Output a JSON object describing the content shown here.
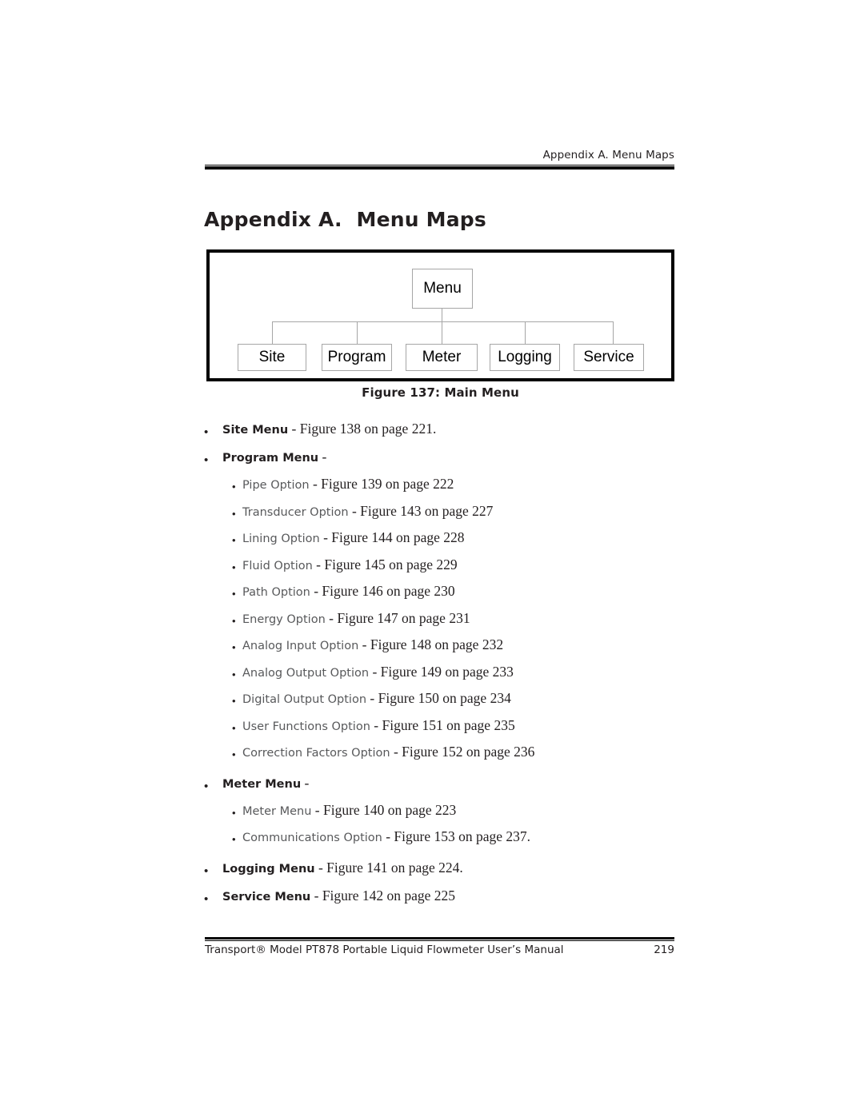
{
  "header": {
    "running_head": "Appendix A. Menu Maps"
  },
  "title": "Appendix A.  Menu Maps",
  "figure": {
    "caption": "Figure 137: Main Menu",
    "root": "Menu",
    "children": [
      "Site",
      "Program",
      "Meter",
      "Logging",
      "Service"
    ]
  },
  "list": [
    {
      "level": 1,
      "label": "Site Menu",
      "ref": " - Figure 138 on page 221."
    },
    {
      "level": 1,
      "label": "Program Menu",
      "ref": " -"
    },
    {
      "level": 2,
      "label": "Pipe Option",
      "ref": " - Figure 139 on page 222"
    },
    {
      "level": 2,
      "label": "Transducer Option",
      "ref": " - Figure 143 on page 227"
    },
    {
      "level": 2,
      "label": "Lining Option",
      "ref": " - Figure 144 on page 228"
    },
    {
      "level": 2,
      "label": "Fluid Option",
      "ref": " - Figure 145 on page 229"
    },
    {
      "level": 2,
      "label": "Path Option",
      "ref": " - Figure 146 on page 230"
    },
    {
      "level": 2,
      "label": "Energy Option",
      "ref": " - Figure 147 on page 231"
    },
    {
      "level": 2,
      "label": "Analog Input Option",
      "ref": " - Figure 148 on page 232"
    },
    {
      "level": 2,
      "label": "Analog Output Option",
      "ref": " - Figure 149 on page 233"
    },
    {
      "level": 2,
      "label": "Digital Output Option",
      "ref": " - Figure 150 on page 234"
    },
    {
      "level": 2,
      "label": "User Functions Option",
      "ref": " - Figure 151 on page 235"
    },
    {
      "level": 2,
      "label": "Correction Factors Option",
      "ref": " - Figure 152 on page 236"
    },
    {
      "level": 1,
      "label": "Meter Menu",
      "ref": " -"
    },
    {
      "level": 2,
      "label": "Meter Menu",
      "ref": " - Figure 140 on page 223"
    },
    {
      "level": 2,
      "label": "Communications Option",
      "ref": " - Figure 153 on page 237."
    },
    {
      "level": 1,
      "label": "Logging Menu",
      "ref": " - Figure 141 on page 224."
    },
    {
      "level": 1,
      "label": "Service Menu",
      "ref": " - Figure 142 on page 225"
    }
  ],
  "bullet_glyph": "•",
  "footer": {
    "text": "Transport® Model PT878 Portable Liquid Flowmeter User’s Manual",
    "page_number": "219"
  },
  "colors": {
    "text": "#231f20",
    "muted": "#58595b",
    "rule": "#000000",
    "node_border": "#a6a6a6"
  }
}
